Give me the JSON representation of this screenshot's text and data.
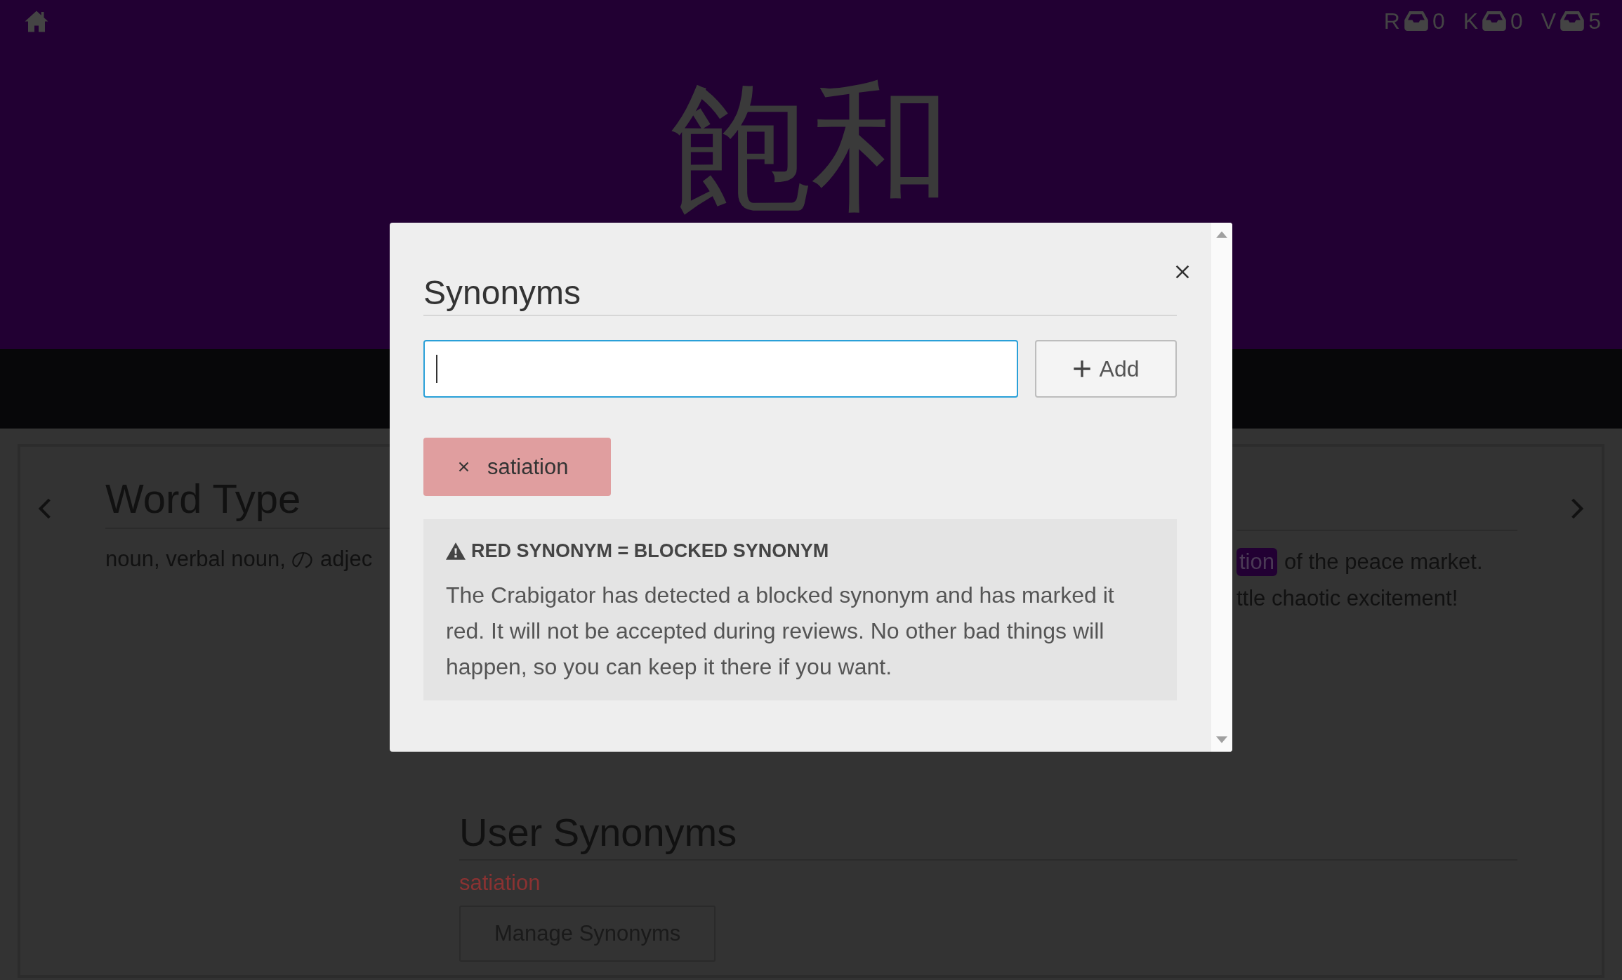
{
  "header": {
    "kanji": "飽和",
    "counters": [
      {
        "letter": "R",
        "count": "0"
      },
      {
        "letter": "K",
        "count": "0"
      },
      {
        "letter": "V",
        "count": "5"
      }
    ]
  },
  "card": {
    "word_type": {
      "heading": "Word Type",
      "text": "noun, verbal noun, の adjec"
    },
    "context": {
      "highlight": "tion",
      "line_1": "of the peace market.",
      "line_2": "ttle chaotic excitement!"
    },
    "user_synonyms": {
      "heading": "User Synonyms",
      "items": [
        {
          "text": "satiation",
          "blocked": true
        }
      ],
      "button": "Manage Synonyms"
    }
  },
  "modal": {
    "title": "Synonyms",
    "input": {
      "focused": true
    },
    "add_button": "Add",
    "synonyms": [
      {
        "text": "satiation",
        "blocked": true
      }
    ],
    "notice": {
      "title": "RED SYNONYM = BLOCKED SYNONYM",
      "text": "The Crabigator has detected a blocked synonym and has marked it red. It will not be accepted during reviews. No other bad things will happen, so you can keep it there if you want."
    }
  }
}
